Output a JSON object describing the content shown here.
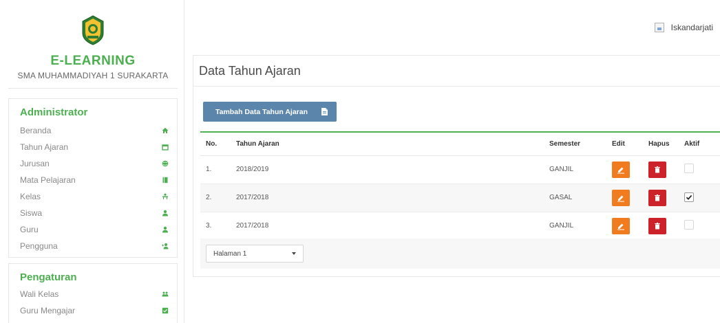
{
  "brand": {
    "title": "E-LEARNING",
    "subtitle": "SMA MUHAMMADIYAH 1 SURAKARTA"
  },
  "topbar": {
    "username": "Iskandarjati"
  },
  "sidebar": {
    "admin": {
      "title": "Administrator",
      "items": [
        {
          "label": "Beranda",
          "icon": "home-icon"
        },
        {
          "label": "Tahun Ajaran",
          "icon": "calendar-icon"
        },
        {
          "label": "Jurusan",
          "icon": "globe-icon"
        },
        {
          "label": "Mata Pelajaran",
          "icon": "book-icon"
        },
        {
          "label": "Kelas",
          "icon": "classroom-icon"
        },
        {
          "label": "Siswa",
          "icon": "user-icon"
        },
        {
          "label": "Guru",
          "icon": "user-icon"
        },
        {
          "label": "Pengguna",
          "icon": "user-add-icon"
        }
      ]
    },
    "settings": {
      "title": "Pengaturan",
      "items": [
        {
          "label": "Wali Kelas",
          "icon": "group-icon"
        },
        {
          "label": "Guru Mengajar",
          "icon": "check-square-icon"
        }
      ]
    }
  },
  "main": {
    "title": "Data Tahun Ajaran",
    "add_button": "Tambah Data Tahun Ajaran",
    "columns": [
      "No.",
      "Tahun Ajaran",
      "Semester",
      "Edit",
      "Hapus",
      "Aktif"
    ],
    "rows": [
      {
        "no": "1.",
        "tahun": "2018/2019",
        "semester": "GANJIL",
        "aktif": false
      },
      {
        "no": "2.",
        "tahun": "2017/2018",
        "semester": "GASAL",
        "aktif": true
      },
      {
        "no": "3.",
        "tahun": "2017/2018",
        "semester": "GANJIL",
        "aktif": false
      }
    ],
    "pager": {
      "selected": "Halaman 1"
    }
  },
  "colors": {
    "accent_green": "#4caf50",
    "button_blue": "#5b85aa",
    "edit_orange": "#f07c1f",
    "delete_red": "#cc2229"
  }
}
